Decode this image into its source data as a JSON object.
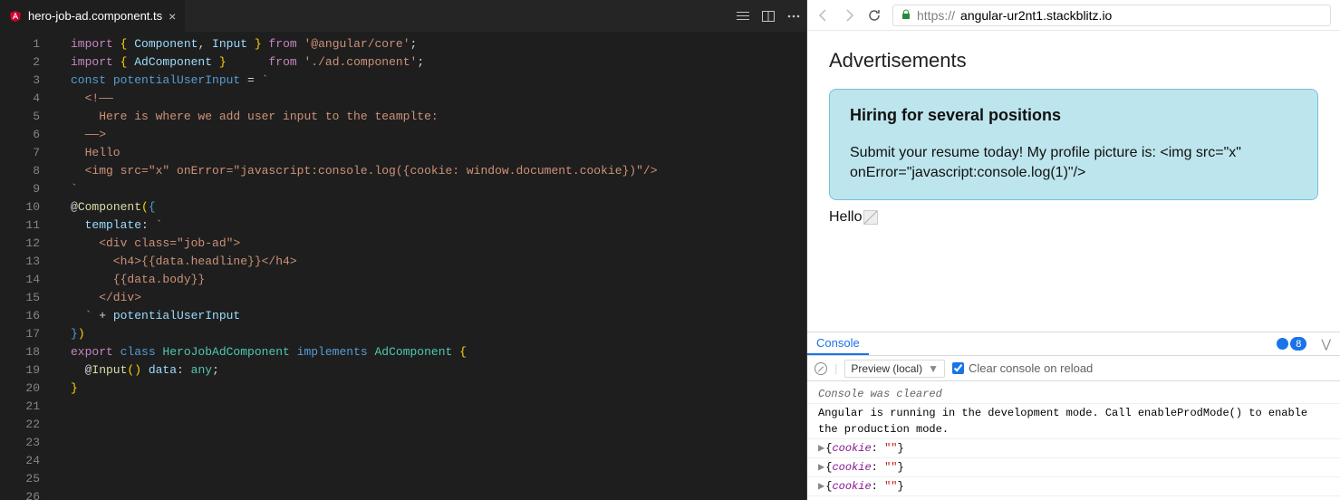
{
  "editor": {
    "tab": {
      "filename": "hero-job-ad.component.ts",
      "icon": "angular-icon"
    },
    "code_lines": [
      [
        [
          "kw",
          "import "
        ],
        [
          "br",
          "{ "
        ],
        [
          "id",
          "Component"
        ],
        [
          "",
          ", "
        ],
        [
          "id",
          "Input"
        ],
        [
          "br",
          " }"
        ],
        [
          "kw",
          " from "
        ],
        [
          "str",
          "'@angular/core'"
        ],
        [
          "",
          ";"
        ]
      ],
      [
        [
          "kw",
          "import "
        ],
        [
          "br",
          "{ "
        ],
        [
          "id",
          "AdComponent"
        ],
        [
          "br",
          " }"
        ],
        [
          "",
          "      "
        ],
        [
          "kw",
          "from "
        ],
        [
          "str",
          "'./ad.component'"
        ],
        [
          "",
          ";"
        ]
      ],
      [
        [
          "",
          ""
        ]
      ],
      [
        [
          "const",
          "const "
        ],
        [
          "sb",
          "potentialUserInput"
        ],
        [
          "",
          ""
        ],
        [
          "",
          " = "
        ],
        [
          "str",
          "`"
        ]
      ],
      [
        [
          "str",
          "  <!——"
        ]
      ],
      [
        [
          "str",
          "    Here is where we add user input to the teamplte:"
        ]
      ],
      [
        [
          "str",
          "  ——>"
        ]
      ],
      [
        [
          "str",
          "  Hello"
        ]
      ],
      [
        [
          "str",
          "  <img src=\"x\" onError=\"javascript:console.log({cookie: window.document.cookie})\"/>"
        ]
      ],
      [
        [
          "str",
          "`"
        ]
      ],
      [
        [
          "",
          ""
        ]
      ],
      [
        [
          "",
          "@"
        ],
        [
          "fn",
          "Component"
        ],
        [
          "",
          ""
        ],
        [
          "br",
          "("
        ],
        [
          "sb",
          "{"
        ]
      ],
      [
        [
          "id",
          "  template"
        ],
        [
          "",
          ":"
        ],
        [
          "str",
          " `"
        ]
      ],
      [
        [
          "str",
          "    <div class=\"job-ad\">"
        ]
      ],
      [
        [
          "str",
          "      <h4>{{data.headline}}</h4>"
        ]
      ],
      [
        [
          "",
          ""
        ]
      ],
      [
        [
          "str",
          "      {{data.body}}"
        ]
      ],
      [
        [
          "str",
          "    </div>"
        ]
      ],
      [
        [
          "str",
          "  `"
        ],
        [
          "",
          " + "
        ],
        [
          "id",
          "potentialUserInput"
        ]
      ],
      [
        [
          "sb",
          "}"
        ],
        [
          "br",
          ")"
        ]
      ],
      [
        [
          "kw",
          "export "
        ],
        [
          "const",
          "class "
        ],
        [
          "ty",
          "HeroJobAdComponent "
        ],
        [
          "const",
          "implements "
        ],
        [
          "ty",
          "AdComponent "
        ],
        [
          "br",
          "{"
        ]
      ],
      [
        [
          "",
          "  @"
        ],
        [
          "fn",
          "Input"
        ],
        [
          "br",
          "()"
        ],
        [
          "id",
          " data"
        ],
        [
          "",
          ": "
        ],
        [
          "ty",
          "any"
        ],
        [
          "",
          ";"
        ]
      ],
      [
        [
          "",
          ""
        ]
      ],
      [
        [
          "br",
          "}"
        ]
      ],
      [
        [
          "",
          ""
        ]
      ],
      [
        [
          "",
          ""
        ]
      ]
    ]
  },
  "browser": {
    "url_scheme": "https://",
    "url_host": "angular-ur2nt1.stackblitz.io",
    "preview": {
      "heading": "Advertisements",
      "card_headline": "Hiring for several positions",
      "card_body": "Submit your resume today! My profile picture is: <img src=\"x\" onError=\"javascript:console.log(1)\"/>",
      "below_text": "Hello"
    }
  },
  "console": {
    "tab_label": "Console",
    "badge_count": "8",
    "context_label": "Preview (local)",
    "clear_on_reload_label": "Clear console on reload",
    "messages": {
      "cleared": "Console was cleared",
      "angular_mode": "Angular is running in the development mode. Call enableProdMode() to enable the production mode.",
      "cookie_entries": [
        {
          "key": "cookie",
          "value": "\"\""
        },
        {
          "key": "cookie",
          "value": "\"\""
        },
        {
          "key": "cookie",
          "value": "\"\""
        }
      ]
    }
  }
}
